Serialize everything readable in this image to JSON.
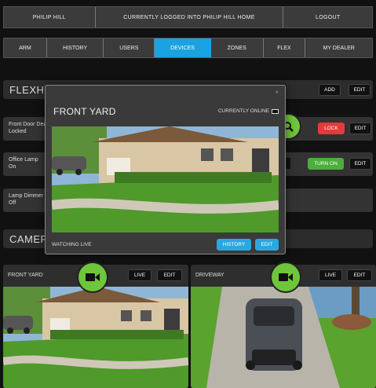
{
  "topbar": {
    "user": "PHILIP HILL",
    "status": "CURRENTLY LOGGED INTO PHILIP HILL HOME",
    "logout": "LOGOUT"
  },
  "nav": {
    "tabs": [
      "ARM",
      "HISTORY",
      "USERS",
      "DEVICES",
      "ZONES",
      "FLEX",
      "MY DEALER"
    ],
    "active": "DEVICES"
  },
  "flexhub": {
    "title": "FLEXHUB",
    "add": "ADD",
    "edit": "EDIT"
  },
  "devices": [
    {
      "name": "Front Door Deadbolt",
      "state": "Locked",
      "action": "LOCK",
      "edit": "EDIT"
    },
    {
      "name": "Office Lamp",
      "state": "On",
      "action": "TURN ON",
      "edit": "EDIT"
    },
    {
      "name": "Lamp Dimmer",
      "state": "Off"
    }
  ],
  "cameras_section": {
    "title": "CAMERAS"
  },
  "cameras": [
    {
      "label": "FRONT YARD",
      "live": "LIVE",
      "edit": "EDIT"
    },
    {
      "label": "DRIVEWAY",
      "live": "LIVE",
      "edit": "EDIT"
    }
  ],
  "modal": {
    "title": "FRONT YARD",
    "status": "CURRENTLY ONLINE",
    "close": "×",
    "footer": "WATCHING LIVE",
    "history": "HISTORY",
    "edit": "EDIT"
  },
  "colors": {
    "accent_blue": "#1aa3e0",
    "lock_red": "#e43a3a",
    "turn_on_green": "#4cae3d",
    "camera_icon_green": "#6fc63b"
  },
  "icons": [
    "video-camera-icon",
    "search-icon",
    "battery-icon",
    "close-icon"
  ]
}
